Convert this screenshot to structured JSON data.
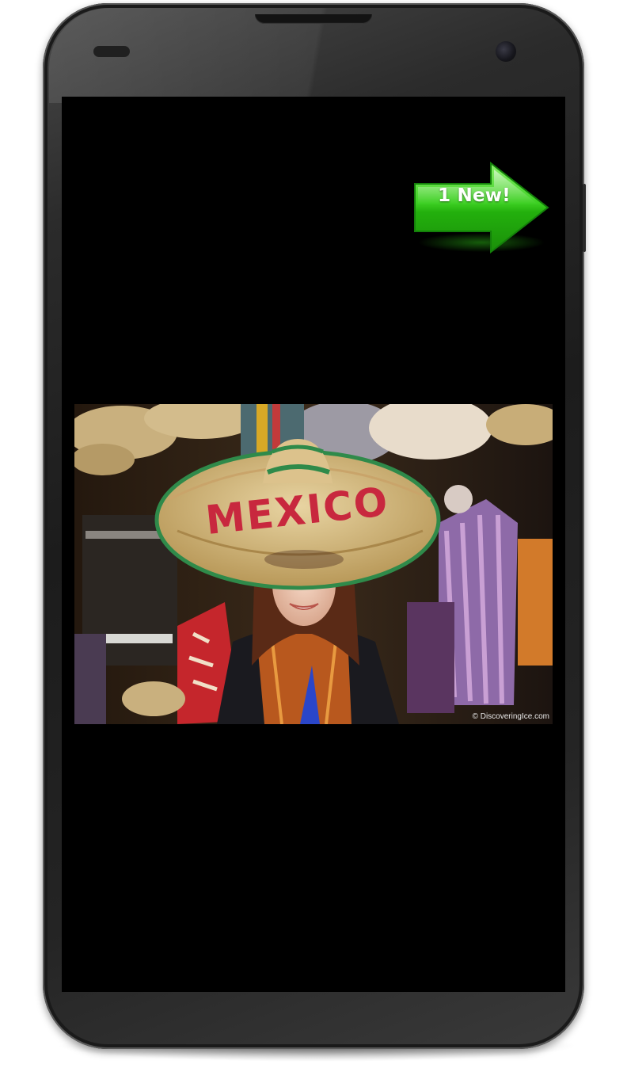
{
  "notification": {
    "label": "1 New!",
    "icon": "green-arrow-right-icon",
    "color": "#2fbf1c"
  },
  "photo": {
    "hat_text": "MEXICO",
    "watermark": "© DiscoveringIce.com"
  },
  "device": {
    "model_style": "nexus-4",
    "screen_bg": "#000000"
  }
}
